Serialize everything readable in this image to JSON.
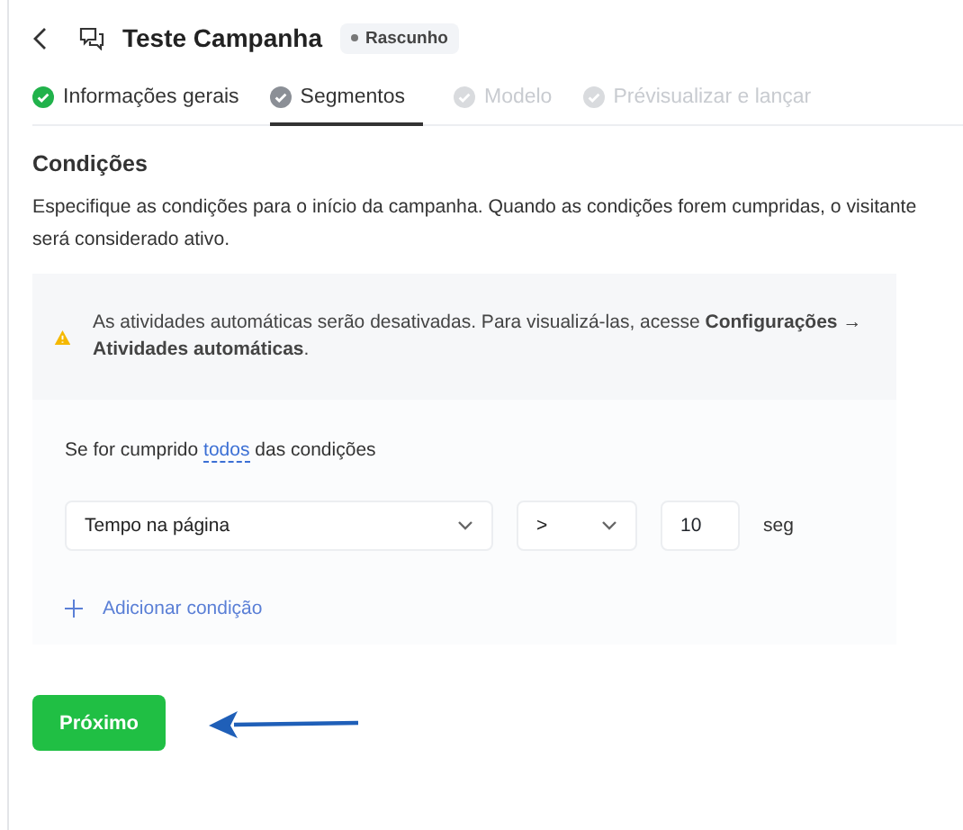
{
  "header": {
    "title": "Teste Campanha",
    "badge": "Rascunho"
  },
  "steps": [
    {
      "label": "Informações gerais",
      "kind": "done",
      "selected": false
    },
    {
      "label": "Segmentos",
      "kind": "current",
      "selected": true
    },
    {
      "label": "Modelo",
      "kind": "pending",
      "selected": false
    },
    {
      "label": "Prévisualizar e lançar",
      "kind": "pending",
      "selected": false
    }
  ],
  "section": {
    "title": "Condições",
    "description": "Especifique as condições para o início da campanha. Quando as condições forem cumpridas, o visitante será considerado ativo."
  },
  "warning": "As atividades automáticas serão desativadas. Para visualizá-las, acesse **Configurações → Atividades automáticas**.",
  "conditions": {
    "prefix": "Se for cumprido",
    "match": "todos",
    "suffix": "das condições",
    "rows": [
      {
        "field": "Tempo na página",
        "operator": ">",
        "value": "10",
        "unit": "seg"
      }
    ],
    "add_label": "Adicionar condição"
  },
  "next_button": "Próximo"
}
